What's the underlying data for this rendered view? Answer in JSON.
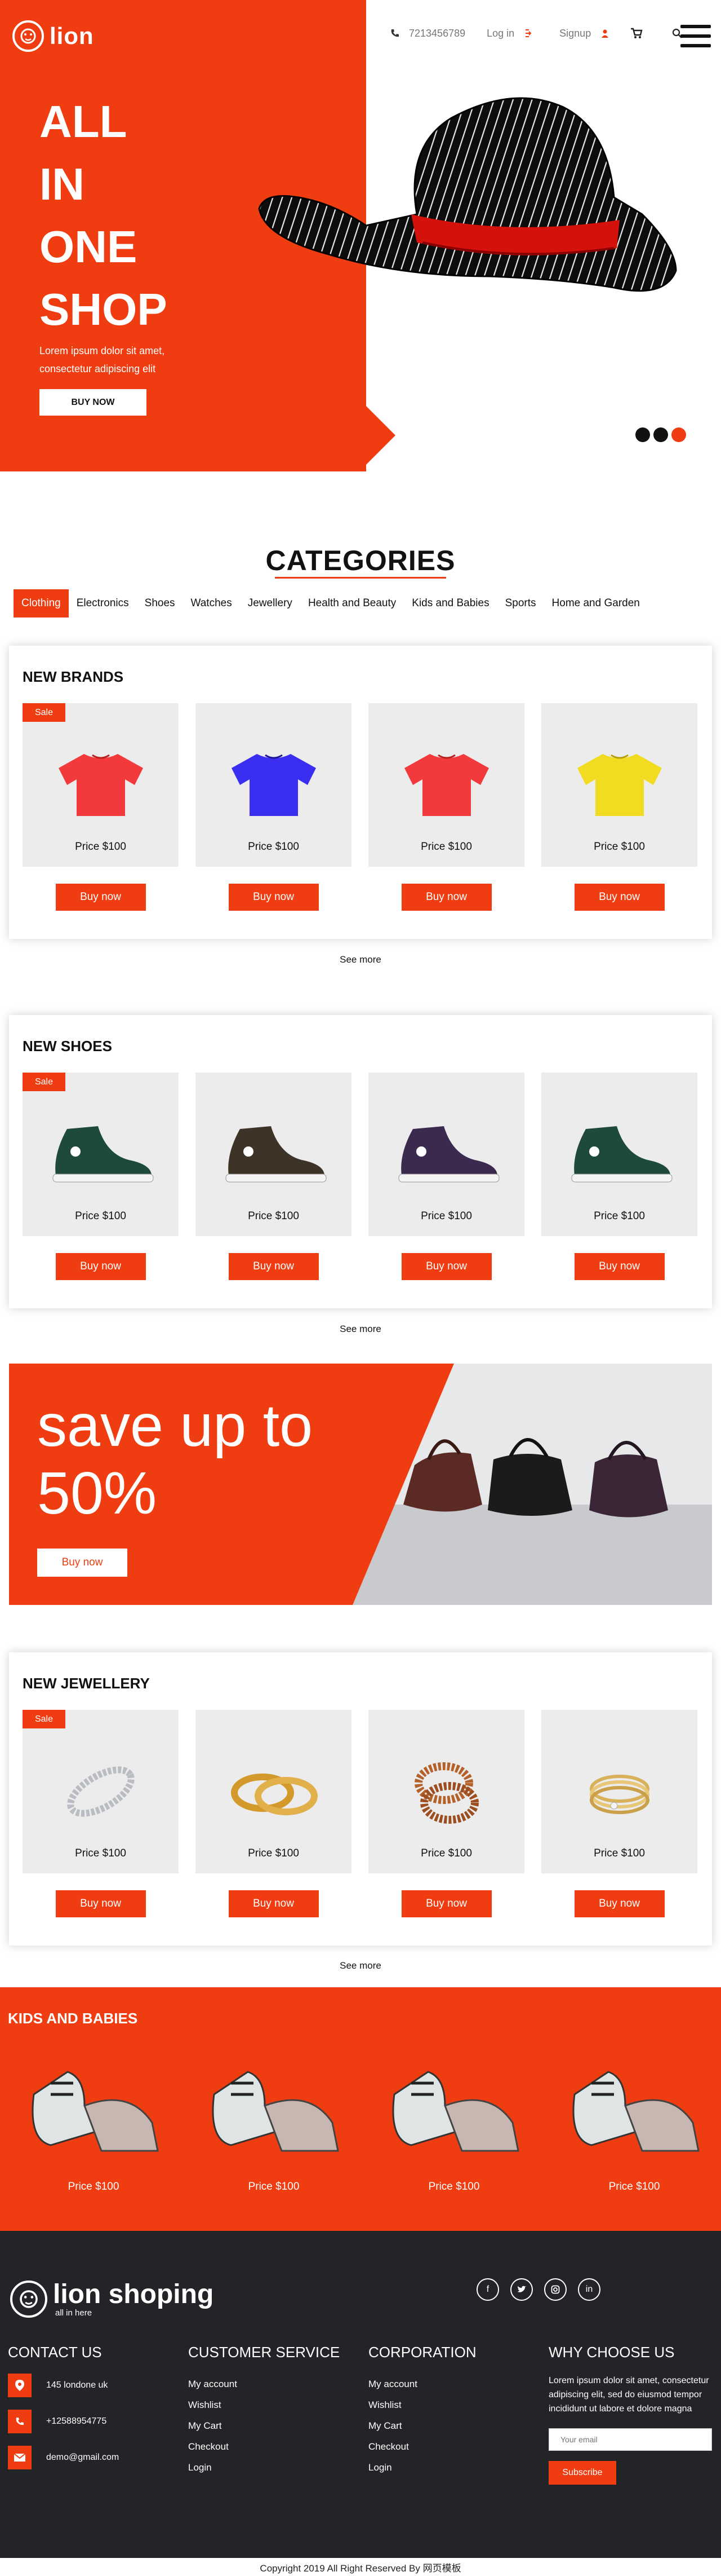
{
  "brand": {
    "name": "lion"
  },
  "topbar": {
    "phone": "7213456789",
    "login": "Log in",
    "signup": "Signup"
  },
  "hero": {
    "title_lines": [
      "ALL",
      "IN",
      "ONE",
      "SHOP"
    ],
    "subtitle": "Lorem ipsum dolor sit amet, consectetur adipiscing elit",
    "button": "BUY NOW",
    "slides": 3,
    "active_slide": 3
  },
  "categories": {
    "title": "CATEGORIES",
    "tabs": [
      "Clothing",
      "Electronics",
      "Shoes",
      "Watches",
      "Jewellery",
      "Health and Beauty",
      "Kids and Babies",
      "Sports",
      "Home and Garden"
    ],
    "active_tab": "Clothing"
  },
  "sections": {
    "brands": {
      "title": "NEW BRANDS",
      "sale": "Sale",
      "items": [
        {
          "price": "Price $100",
          "buy": "Buy now",
          "color": "#f23a3c"
        },
        {
          "price": "Price $100",
          "buy": "Buy now",
          "color": "#3a2ef0"
        },
        {
          "price": "Price $100",
          "buy": "Buy now",
          "color": "#f23a3c"
        },
        {
          "price": "Price $100",
          "buy": "Buy now",
          "color": "#f2dc22"
        }
      ],
      "see_more": "See more"
    },
    "shoes": {
      "title": "NEW SHOES",
      "sale": "Sale",
      "items": [
        {
          "price": "Price $100",
          "buy": "Buy now",
          "color": "#1e4a3a"
        },
        {
          "price": "Price $100",
          "buy": "Buy now",
          "color": "#3d3326"
        },
        {
          "price": "Price $100",
          "buy": "Buy now",
          "color": "#3b2a4e"
        },
        {
          "price": "Price $100",
          "buy": "Buy now",
          "color": "#1e4a3a"
        }
      ],
      "see_more": "See more"
    },
    "jewellery": {
      "title": "NEW JEWELLERY",
      "sale": "Sale",
      "items": [
        {
          "price": "Price $100",
          "buy": "Buy now"
        },
        {
          "price": "Price $100",
          "buy": "Buy now"
        },
        {
          "price": "Price $100",
          "buy": "Buy now"
        },
        {
          "price": "Price $100",
          "buy": "Buy now"
        }
      ],
      "see_more": "See more"
    }
  },
  "promo": {
    "line1": "save up to",
    "line2": "50%",
    "button": "Buy now"
  },
  "kids": {
    "title": "KIDS AND BABIES",
    "items": [
      {
        "price": "Price $100"
      },
      {
        "price": "Price $100"
      },
      {
        "price": "Price $100"
      },
      {
        "price": "Price $100"
      }
    ]
  },
  "footer": {
    "brand": "lion shoping",
    "tagline": "all in here",
    "contact": {
      "title": "CONTACT US",
      "address": "145 londone uk",
      "phone": "+12588954775",
      "email": "demo@gmail.com"
    },
    "customer_service": {
      "title": "CUSTOMER SERVICE",
      "links": [
        "My account",
        "Wishlist",
        "My Cart",
        "Checkout",
        "Login"
      ]
    },
    "corporation": {
      "title": "CORPORATION",
      "links": [
        "My account",
        "Wishlist",
        "My Cart",
        "Checkout",
        "Login"
      ]
    },
    "why": {
      "title": "WHY CHOOSE US",
      "text": "Lorem ipsum dolor sit amet, consectetur adipiscing elit, sed do eiusmod tempor incididunt ut labore et dolore magna",
      "email_placeholder": "Your email",
      "subscribe": "Subscribe"
    },
    "copyright": "Copyright 2019 All Right Reserved By 网页模板"
  },
  "colors": {
    "accent": "#f03c11",
    "dark": "#232427"
  }
}
